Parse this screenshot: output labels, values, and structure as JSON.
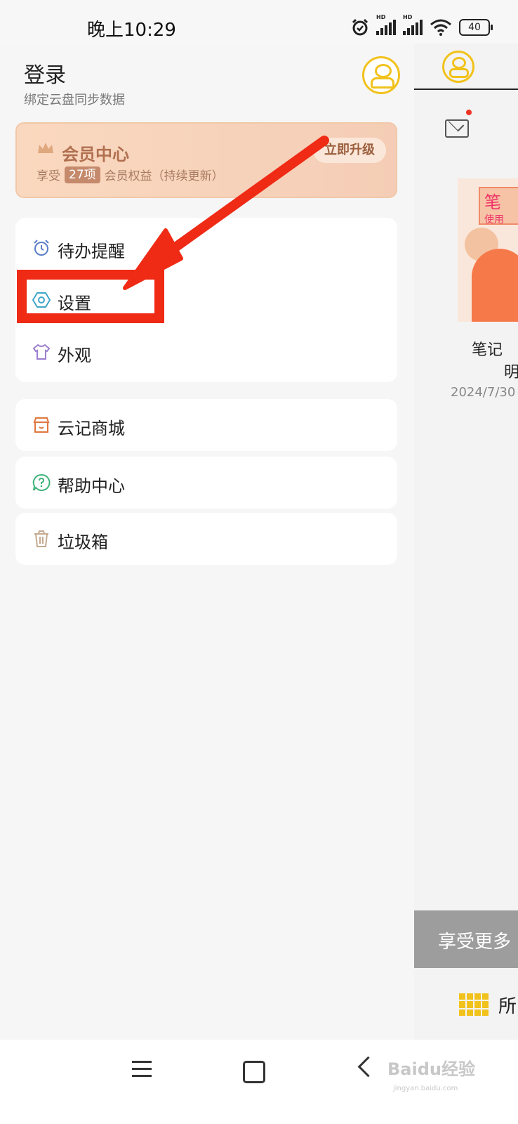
{
  "status_bar": {
    "time": "晚上10:29",
    "battery": "40",
    "hd1": "HD",
    "hd2": "HD"
  },
  "drawer": {
    "login_title": "登录",
    "login_subtitle": "绑定云盘同步数据",
    "vip": {
      "title": "会员中心",
      "desc_prefix": "享受",
      "badge": "27项",
      "desc_suffix": "会员权益（持续更新）",
      "button": "立即升级"
    },
    "menu_group1": [
      {
        "label": "待办提醒",
        "icon": "alarm-clock-icon"
      },
      {
        "label": "设置",
        "icon": "settings-hexagon-icon"
      },
      {
        "label": "外观",
        "icon": "tshirt-icon"
      }
    ],
    "menu_group2": [
      {
        "label": "云记商城",
        "icon": "store-icon"
      },
      {
        "label": "帮助中心",
        "icon": "help-chat-icon"
      },
      {
        "label": "垃圾箱",
        "icon": "trash-icon"
      }
    ]
  },
  "right_panel": {
    "thumb_text1": "笔",
    "thumb_text2": "使用",
    "note_title": "笔记",
    "note_title_line2": "明",
    "note_date": "2024/7/30",
    "promo": "享受更多",
    "bottom_label": "所"
  },
  "watermark": {
    "text": "Baidu经验",
    "sub": "jingyan.baidu.com"
  },
  "colors": {
    "accent_yellow": "#f2c21c",
    "annotation_red": "#ef2a15",
    "vip_bg": "#f7d3bb"
  }
}
